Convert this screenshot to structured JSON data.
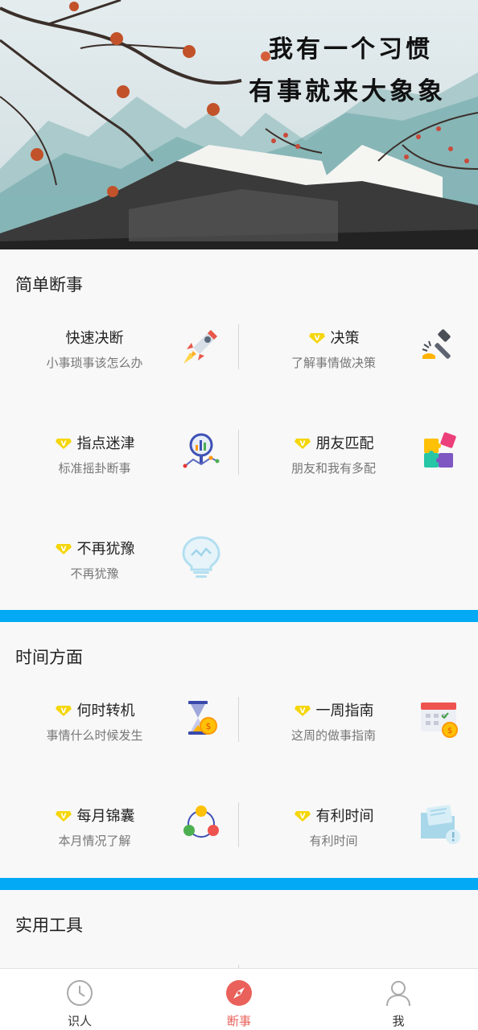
{
  "banner": {
    "line1": "我有一个习惯",
    "line2": "有事就来大象象"
  },
  "sections": [
    {
      "title": "简单断事",
      "items": [
        {
          "title": "快速决断",
          "subtitle": "小事琐事该怎么办",
          "vip": false,
          "icon": "rocket-icon"
        },
        {
          "title": "决策",
          "subtitle": "了解事情做决策",
          "vip": true,
          "icon": "gavel-icon"
        },
        {
          "title": "指点迷津",
          "subtitle": "标准摇卦断事",
          "vip": true,
          "icon": "magnifier-chart-icon"
        },
        {
          "title": "朋友匹配",
          "subtitle": "朋友和我有多配",
          "vip": true,
          "icon": "puzzle-icon"
        },
        {
          "title": "不再犹豫",
          "subtitle": "不再犹豫",
          "vip": true,
          "icon": "lightbulb-icon"
        }
      ]
    },
    {
      "title": "时间方面",
      "items": [
        {
          "title": "何时转机",
          "subtitle": "事情什么时候发生",
          "vip": true,
          "icon": "hourglass-coin-icon"
        },
        {
          "title": "一周指南",
          "subtitle": "这周的做事指南",
          "vip": true,
          "icon": "calendar-coin-icon"
        },
        {
          "title": "每月锦囊",
          "subtitle": "本月情况了解",
          "vip": true,
          "icon": "cycle-dots-icon"
        },
        {
          "title": "有利时间",
          "subtitle": "有利时间",
          "vip": true,
          "icon": "folder-alert-icon"
        }
      ]
    },
    {
      "title": "实用工具",
      "items": []
    }
  ],
  "tabs": [
    {
      "label": "识人",
      "icon": "clock-icon",
      "active": false
    },
    {
      "label": "断事",
      "icon": "compass-icon",
      "active": true
    },
    {
      "label": "我",
      "icon": "user-icon",
      "active": false
    }
  ],
  "colors": {
    "accent": "#03a9f4",
    "active_tab": "#e9615a",
    "vip_badge": "#f5d60b"
  }
}
